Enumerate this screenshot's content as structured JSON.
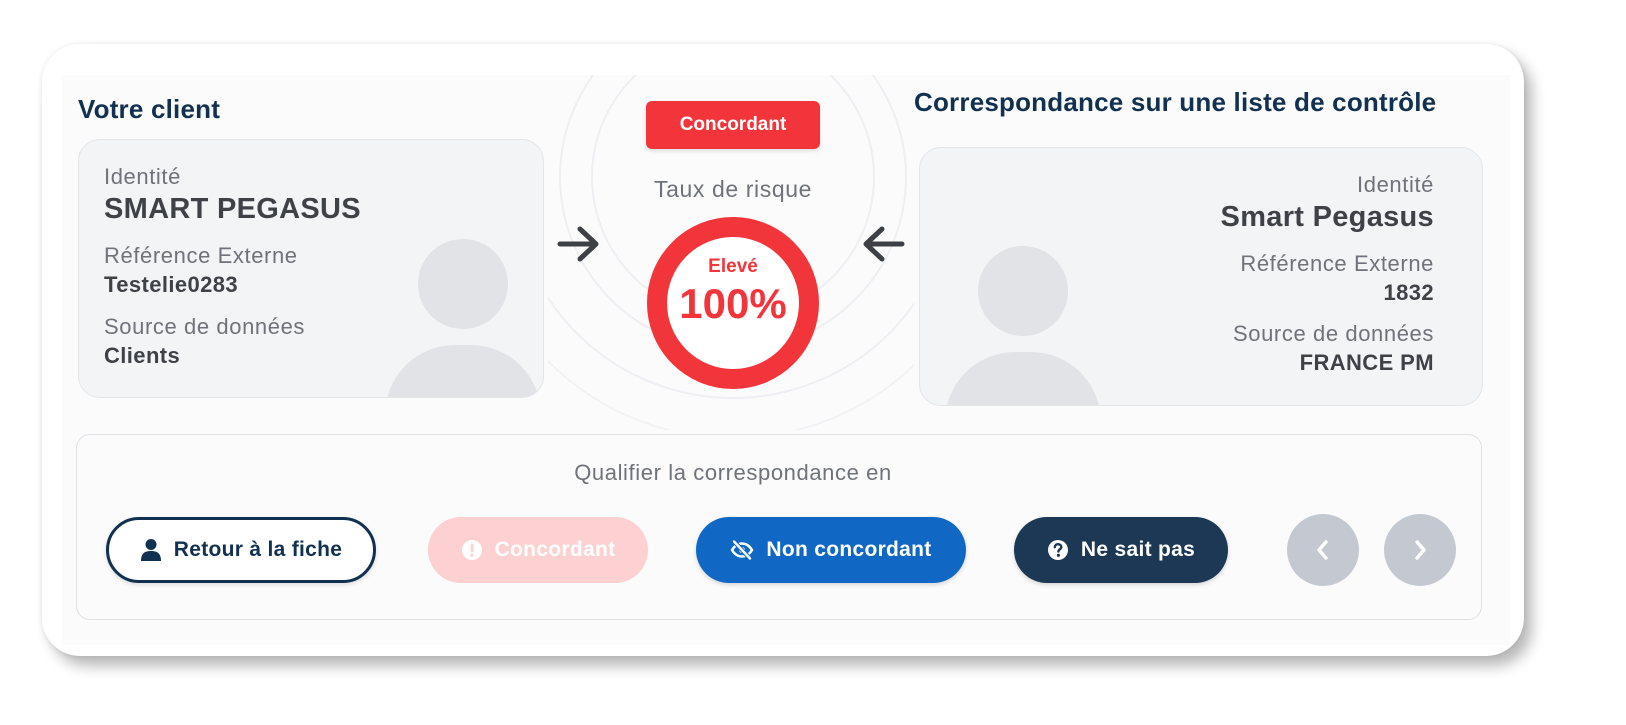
{
  "client": {
    "title": "Votre client",
    "identity_label": "Identité",
    "identity_value": "SMART PEGASUS",
    "ref_label": "Référence Externe",
    "ref_value": "Testelie0283",
    "source_label": "Source de données",
    "source_value": "Clients"
  },
  "watchlist": {
    "title": "Correspondance sur une liste de contrôle",
    "identity_label": "Identité",
    "identity_value": "Smart Pegasus",
    "ref_label": "Référence Externe",
    "ref_value": "1832",
    "source_label": "Source de données",
    "source_value": "FRANCE PM"
  },
  "match": {
    "status_badge": "Concordant",
    "risk_label": "Taux de risque",
    "risk_level": "Elevé",
    "risk_value": "100%",
    "risk_fraction": 1.0
  },
  "qualification": {
    "prompt": "Qualifier la correspondance en",
    "back_button": "Retour à la fiche",
    "concordant_button": "Concordant",
    "non_concordant_button": "Non concordant",
    "unknown_button": "Ne sait pas"
  },
  "icons": {
    "back": "user-icon",
    "concordant": "exclamation-circle-icon",
    "non_concordant": "eye-slash-icon",
    "unknown": "question-circle-icon",
    "prev": "chevron-left-icon",
    "next": "chevron-right-icon",
    "arrow_right": "arrow-right-icon",
    "arrow_left": "arrow-left-icon"
  },
  "colors": {
    "title": "#12304f",
    "risk_red": "#f2353b",
    "concordant_disabled": "#fdd0d1",
    "non_concordant_blue": "#1168c4",
    "unknown_navy": "#1c3855",
    "nav_grey": "#c4c9d1"
  }
}
